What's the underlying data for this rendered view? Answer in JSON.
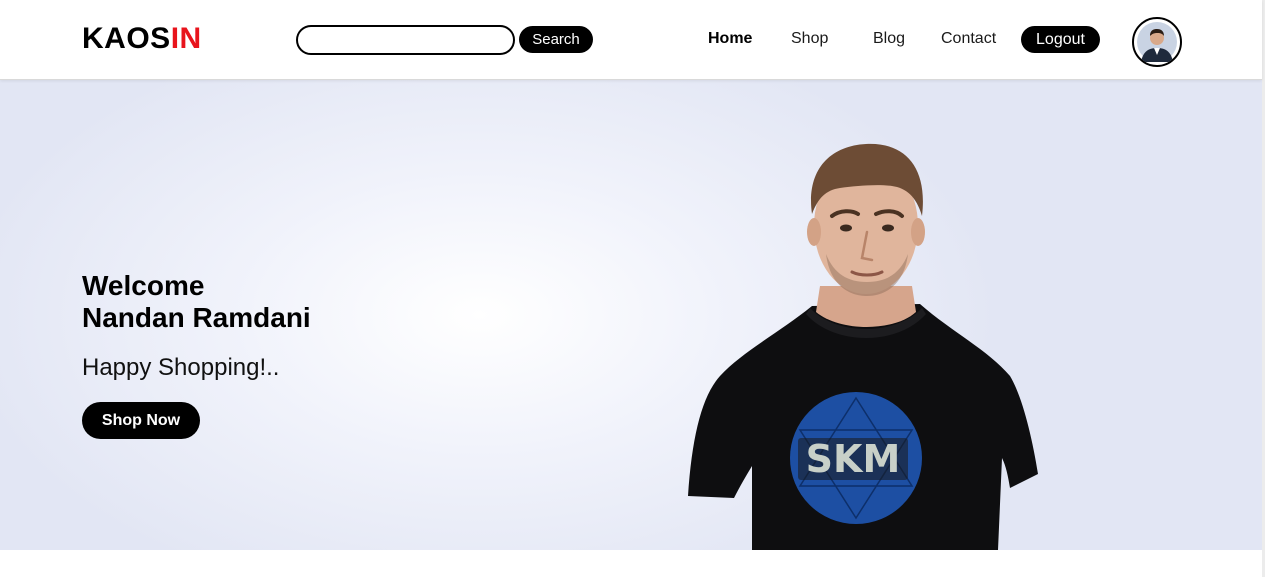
{
  "header": {
    "logo_main": "KAOS",
    "logo_accent": "IN",
    "search": {
      "value": "",
      "placeholder": "",
      "button_label": "Search"
    },
    "nav": [
      {
        "label": "Home",
        "active": true
      },
      {
        "label": "Shop",
        "active": false
      },
      {
        "label": "Blog",
        "active": false
      },
      {
        "label": "Contact",
        "active": false
      }
    ],
    "logout_label": "Logout",
    "avatar_icon": "user-avatar-icon"
  },
  "hero": {
    "title_line1": "Welcome",
    "title_line2": "Nandan Ramdani",
    "subtitle": "Happy Shopping!..",
    "cta_label": "Shop Now",
    "shirt_print": "SKM"
  },
  "colors": {
    "accent": "#e8141c",
    "button_bg": "#000000",
    "button_text": "#ffffff",
    "hero_bg": "#e2e6f4",
    "shirt_circle": "#1d4fa3"
  }
}
